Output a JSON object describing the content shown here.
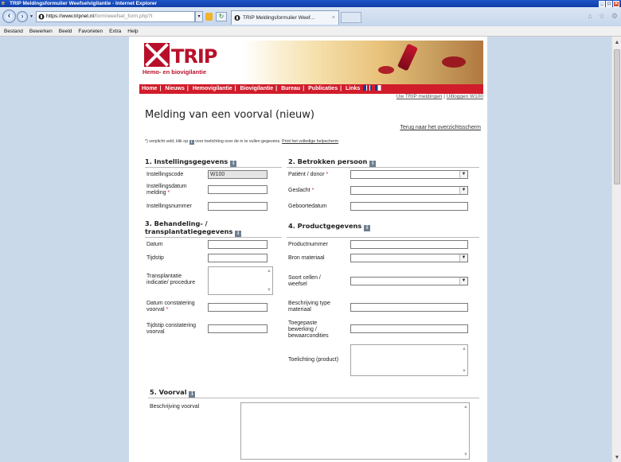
{
  "window": {
    "title": "TRIP Meldingsformulier Weefselvigilantie - Internet Explorer",
    "minimize": "_",
    "maximize": "□",
    "close": "✕"
  },
  "browser": {
    "url_host": "https://www.tripnet.nl",
    "url_rest": "/form/weefsel_form.php?t",
    "tab_title": "TRIP Meldingsformulier Weef...",
    "tab_close": "×"
  },
  "menu": [
    "Bestand",
    "Bewerken",
    "Beeld",
    "Favorieten",
    "Extra",
    "Help"
  ],
  "site": {
    "logo_text": "TRIP",
    "logo_sub": "Hemo- en biovigilantie",
    "nav": [
      "Home",
      "Nieuws",
      "Hemovigilantie",
      "Biovigilantie",
      "Bureau",
      "Publicaties",
      "Links"
    ],
    "user_link_1": "Uw TRIP meldingen",
    "user_link_2": "Uitloggen W100"
  },
  "form": {
    "page_title": "Melding van een voorval (nieuw)",
    "back_link": "Terug naar het overzichtsscherm",
    "hint_prefix": "*) verplicht veld, klik op",
    "hint_suffix": "voor toelichting over de in te vullen gegevens.",
    "hint_link": "Print het volledige helpscherm",
    "req_mark": "*",
    "info_glyph": "i",
    "sections": {
      "s1": "1. Instellingsgegevens",
      "s2": "2. Betrokken persoon",
      "s3a": "3. Behandeling- /",
      "s3b": "transplantatiegegevens",
      "s4": "4. Productgegevens",
      "s5": "5. Voorval"
    },
    "labels": {
      "instellingscode": "Instellingscode",
      "instellingsdatum_a": "Instellingsdatum",
      "instellingsdatum_b": "melding",
      "instellingsnummer": "Instellingsnummer",
      "patient": "Patiënt / donor",
      "geslacht": "Geslacht",
      "geboortedatum": "Geboortedatum",
      "datum": "Datum",
      "tijdstip": "Tijdstip",
      "transplantatie_a": "Transplantatie",
      "transplantatie_b": "indicatie/ procedure",
      "datum_const_a": "Datum constatering",
      "datum_const_b": "voorval",
      "tijdstip_const_a": "Tijdstip constatering",
      "tijdstip_const_b": "voorval",
      "productnummer": "Productnummer",
      "bron": "Bron materiaal",
      "soort_a": "Soort cellen /",
      "soort_b": "weefsel",
      "beschrijving_type_a": "Beschrijving type",
      "beschrijving_type_b": "materiaal",
      "toegepaste_a": "Toegepaste",
      "toegepaste_b": "bewerking /",
      "toegepaste_c": "bewaarcondities",
      "toelichting": "Toelichting (product)",
      "beschrijving_voorval": "Beschrijving voorval"
    },
    "values": {
      "instellingscode": "W100"
    }
  }
}
